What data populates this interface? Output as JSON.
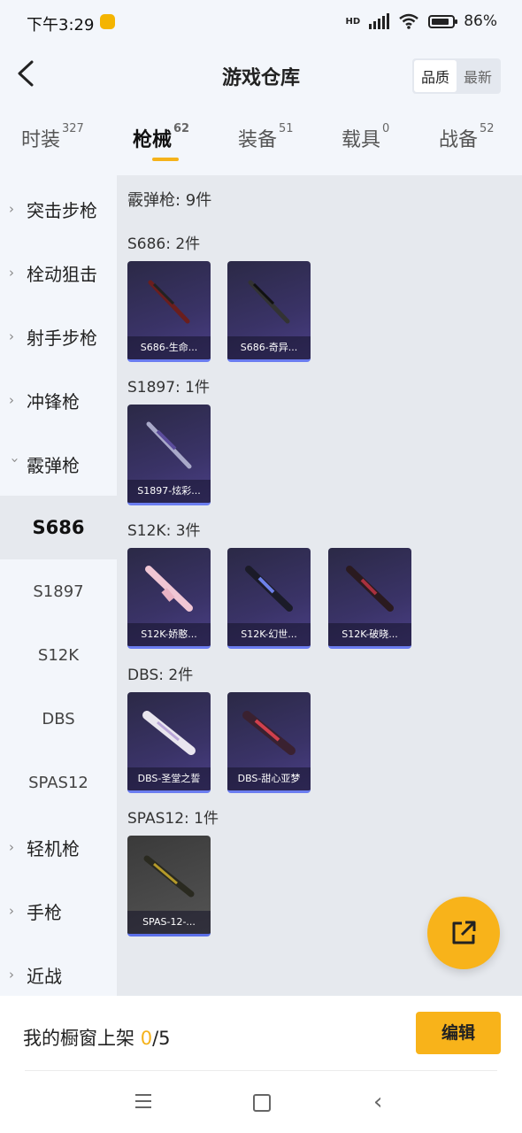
{
  "status_bar": {
    "time": "下午3:29",
    "hd": "HD",
    "battery": "86%"
  },
  "header": {
    "title": "游戏仓库",
    "sort_quality": "品质",
    "sort_latest": "最新"
  },
  "tabs": [
    {
      "label": "时装",
      "count": "327"
    },
    {
      "label": "枪械",
      "count": "62"
    },
    {
      "label": "装备",
      "count": "51"
    },
    {
      "label": "载具",
      "count": "0"
    },
    {
      "label": "战备",
      "count": "52"
    }
  ],
  "sidebar": {
    "items": [
      {
        "label": "突击步枪"
      },
      {
        "label": "栓动狙击"
      },
      {
        "label": "射手步枪"
      },
      {
        "label": "冲锋枪"
      },
      {
        "label": "霰弹枪"
      },
      {
        "label": "S686"
      },
      {
        "label": "S1897"
      },
      {
        "label": "S12K"
      },
      {
        "label": "DBS"
      },
      {
        "label": "SPAS12"
      },
      {
        "label": "轻机枪"
      },
      {
        "label": "手枪"
      },
      {
        "label": "近战"
      }
    ]
  },
  "main": {
    "total": "霰弹枪: 9件",
    "sections": [
      {
        "label": "S686: 2件",
        "items": [
          {
            "name": "S686-生命..."
          },
          {
            "name": "S686-奇异..."
          }
        ]
      },
      {
        "label": "S1897: 1件",
        "items": [
          {
            "name": "S1897-炫彩..."
          }
        ]
      },
      {
        "label": "S12K: 3件",
        "items": [
          {
            "name": "S12K-娇憨..."
          },
          {
            "name": "S12K-幻世..."
          },
          {
            "name": "S12K-破晓..."
          }
        ]
      },
      {
        "label": "DBS: 2件",
        "items": [
          {
            "name": "DBS-圣堂之誓"
          },
          {
            "name": "DBS-甜心亚梦"
          }
        ]
      },
      {
        "label": "SPAS12: 1件",
        "items": [
          {
            "name": "SPAS-12-..."
          }
        ]
      }
    ]
  },
  "bottom": {
    "label": "我的橱窗上架 ",
    "count_current": "0",
    "count_total": "/5",
    "edit_button": "编辑"
  },
  "colors": {
    "accent": "#f8b31a",
    "card_bg": "#3a3367",
    "card_border": "#6b7df0"
  }
}
